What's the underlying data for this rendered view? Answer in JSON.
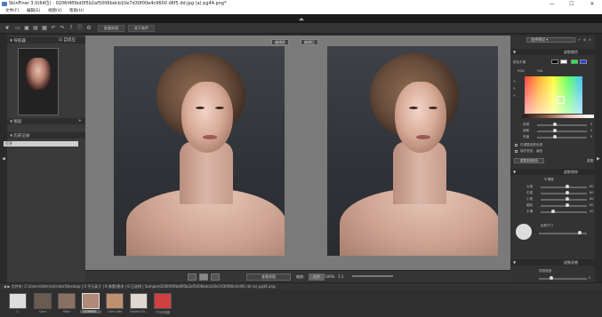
{
  "window": {
    "title": "SkinFiner 3.0(64位) - 0206f4f0bd0f5b2af5006bdcb10e7d30f00e4c9600 d6f5 dd.jpg (a) pg44.png*",
    "minimize": "—",
    "maximize": "☐",
    "close": "✕"
  },
  "menu": {
    "items": [
      "文件(F)",
      "编辑(E)",
      "视图(V)",
      "帮助(H)"
    ]
  },
  "toolbar": {
    "button1": "批量处理",
    "button2": "关于软件"
  },
  "left_panel": {
    "nav_header": "导航器",
    "nav_toggle": "自适应",
    "layers_header": "图层",
    "history_header": "历史记录",
    "history_item": "打开"
  },
  "center": {
    "left_label": "编辑前",
    "right_label": "编辑后",
    "bottom_center_label": "查看原图",
    "zoom_label": "缩放:",
    "zoom_value": "适合",
    "zoom_options": "100%",
    "ratio": "1:1"
  },
  "right_panel": {
    "preset_label": "选择预设",
    "section1": "皮肤颜色",
    "tone_label": "肤色平衡",
    "tab_rgb": "RGB",
    "tab_hsl": "HSL",
    "row_labels": [
      "色相",
      "饱和",
      "亮度"
    ],
    "row_values": [
      "0",
      "0",
      "0"
    ],
    "check1": "仅调整皮肤色调",
    "check2": "保护发色、眉色",
    "reset": "重置皮肤颜色",
    "reset_btn": "重置",
    "section2": "皮肤修饰",
    "sub_label": "平滑度",
    "smooth_labels": [
      "大斑",
      "中斑",
      "小斑",
      "细纹",
      "平滑"
    ],
    "smooth_values": [
      "60",
      "60",
      "60",
      "60",
      "20"
    ],
    "brush_label": "皮肤尺寸",
    "section3": "皮肤质感",
    "texture_label": "质感强度",
    "texture_value": "0"
  },
  "path_bar": {
    "text": "◀ ▶  文件夹: C:\\Users\\Administrator\\Desktop  |  0 平方英寸  |  6 像素/厘米  |  6 已选择  |  Sample(0206f4f0bd0f5b2af5006bdcb10e7d30f00e4c96) dd (a) pg44.png"
  },
  "filmstrip": {
    "items": [
      "C:",
      "Cece",
      "Fabio",
      "0206f4f0...",
      "Cafe Latte",
      "Fashion Br...",
      "户外写真图"
    ]
  },
  "colors": {
    "app_bg": "#2b2b2b",
    "canvas_bg": "#7a7a7a",
    "swatch_black": "#000000",
    "swatch_white": "#ffffff",
    "swatch_green": "#00ff40",
    "swatch_blue": "#2040ff"
  }
}
